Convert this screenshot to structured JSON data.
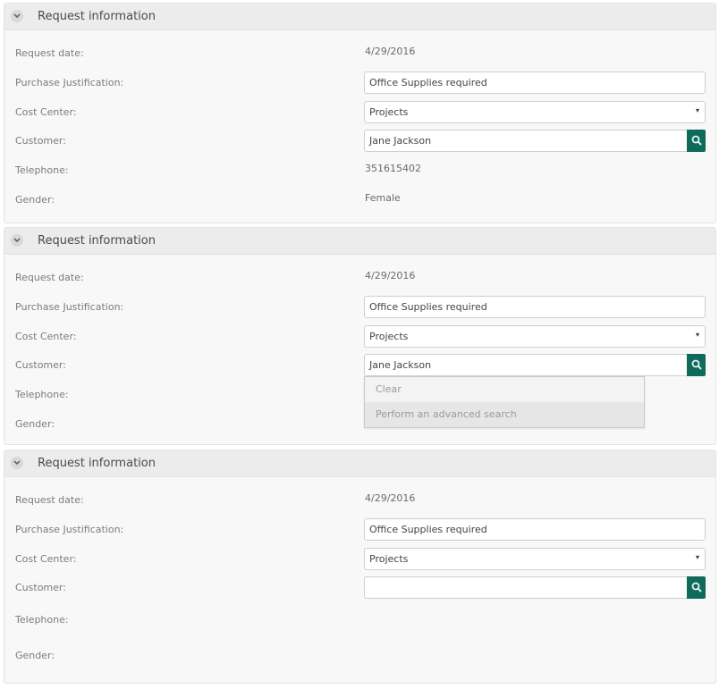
{
  "colors": {
    "accent": "#0e6b5b",
    "header_bg": "#ececec",
    "panel_bg": "#f8f8f8"
  },
  "icons": {
    "collapse": "chevron-down-icon",
    "search": "search-icon",
    "caret": "caret-down-icon"
  },
  "panels": [
    {
      "title": "Request information",
      "request_date_label": "Request date:",
      "request_date_value": "4/29/2016",
      "justification_label": "Purchase Justification:",
      "justification_value": "Office Supplies required",
      "cost_center_label": "Cost Center:",
      "cost_center_value": "Projects",
      "customer_label": "Customer:",
      "customer_value": "Jane Jackson",
      "telephone_label": "Telephone:",
      "telephone_value": "351615402",
      "gender_label": "Gender:",
      "gender_value": "Female"
    },
    {
      "title": "Request information",
      "request_date_label": "Request date:",
      "request_date_value": "4/29/2016",
      "justification_label": "Purchase Justification:",
      "justification_value": "Office Supplies required",
      "cost_center_label": "Cost Center:",
      "cost_center_value": "Projects",
      "customer_label": "Customer:",
      "customer_value": "Jane Jackson",
      "telephone_label": "Telephone:",
      "gender_label": "Gender:",
      "dropdown": {
        "items": [
          "Clear",
          "Perform an advanced search"
        ]
      }
    },
    {
      "title": "Request information",
      "request_date_label": "Request date:",
      "request_date_value": "4/29/2016",
      "justification_label": "Purchase Justification:",
      "justification_value": "Office Supplies required",
      "cost_center_label": "Cost Center:",
      "cost_center_value": "Projects",
      "customer_label": "Customer:",
      "customer_value": "",
      "telephone_label": "Telephone:",
      "gender_label": "Gender:"
    }
  ]
}
